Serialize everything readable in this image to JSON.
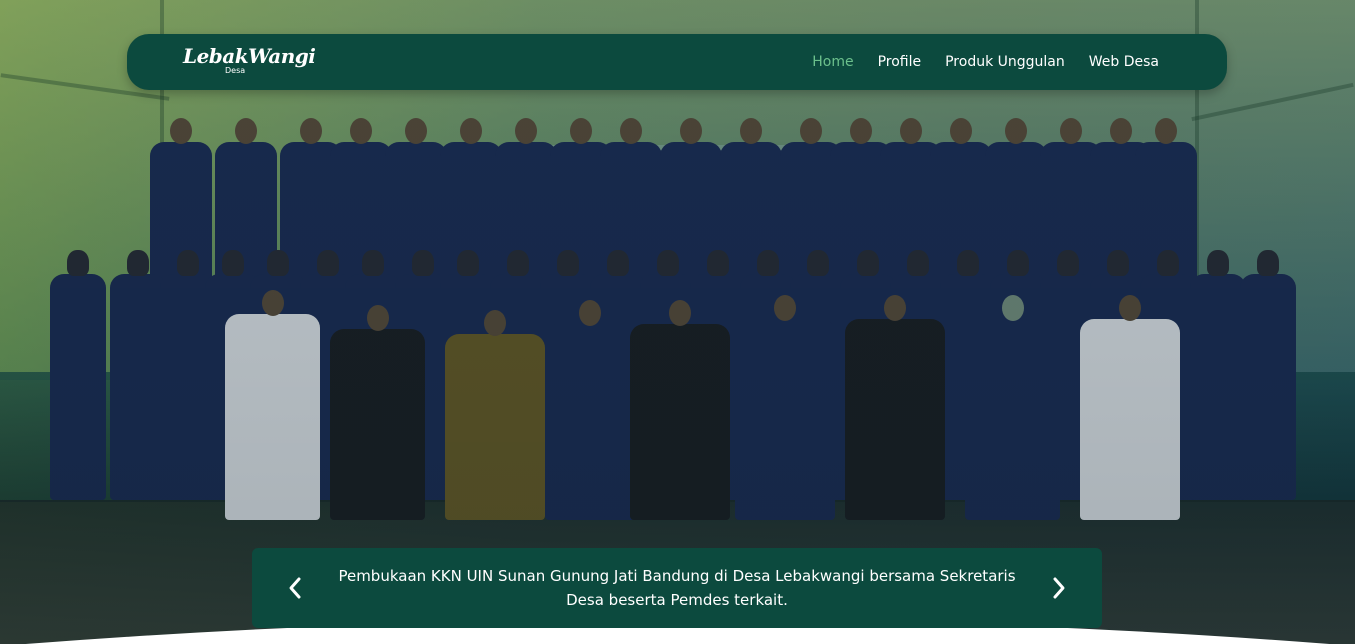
{
  "brand": {
    "name": "LebakWangi",
    "subtitle": "Desa"
  },
  "nav": {
    "items": [
      {
        "label": "Home",
        "active": true
      },
      {
        "label": "Profile",
        "active": false
      },
      {
        "label": "Produk Unggulan",
        "active": false
      },
      {
        "label": "Web Desa",
        "active": false
      }
    ]
  },
  "slider": {
    "caption": "Pembukaan KKN UIN Sunan Gunung Jati Bandung di Desa Lebakwangi bersama Sekretaris Desa beserta Pemdes terkait.",
    "prev_icon": "chevron-left-icon",
    "next_icon": "chevron-right-icon"
  },
  "colors": {
    "navbar_bg": "#0c4a3e",
    "active_link": "#6cc08c",
    "text": "#ffffff"
  }
}
